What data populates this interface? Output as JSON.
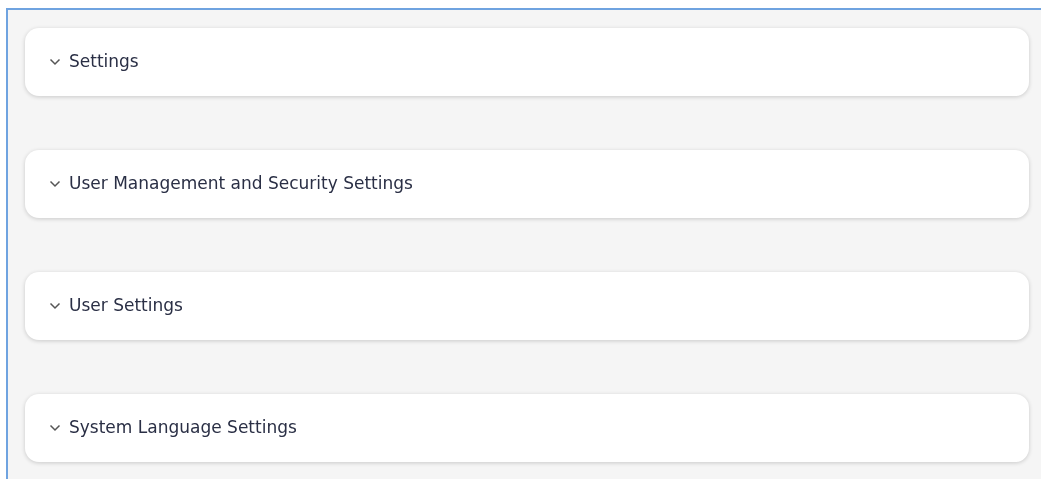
{
  "sections": [
    {
      "title": "Settings",
      "expanded": false
    },
    {
      "title": "User Management and Security Settings",
      "expanded": false
    },
    {
      "title": "User Settings",
      "expanded": false
    },
    {
      "title": "System Language Settings",
      "expanded": false
    }
  ]
}
